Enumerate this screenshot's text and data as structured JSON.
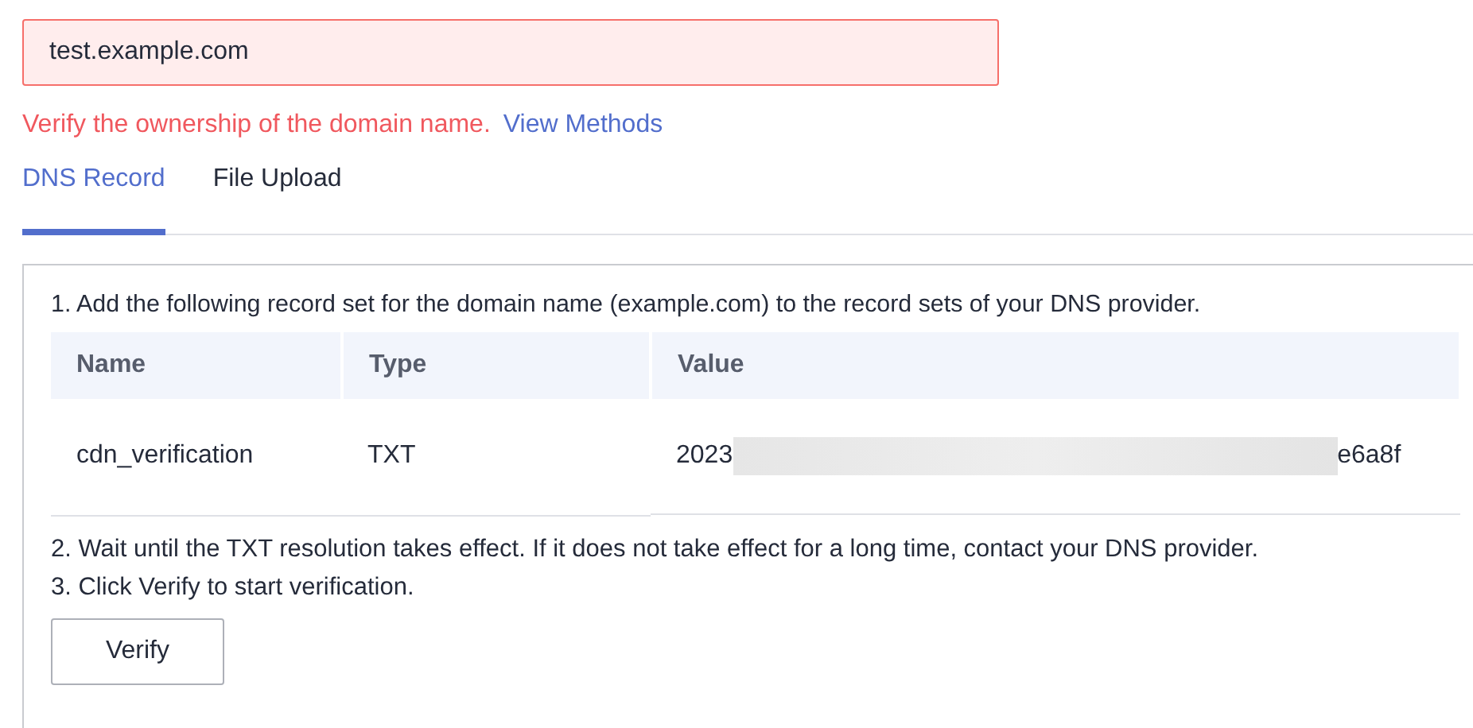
{
  "domain_field": {
    "value": "test.example.com",
    "invalid": true
  },
  "error": {
    "message": "Verify the ownership of the domain name.",
    "link": "View Methods"
  },
  "tabs": [
    {
      "label": "DNS Record",
      "selected": true
    },
    {
      "label": "File Upload",
      "selected": false
    }
  ],
  "steps": [
    {
      "kind": "text",
      "text": "1. Add the following record set for the domain name (example.com) to the record sets of your DNS provider."
    },
    {
      "kind": "table",
      "columns": [
        "Name",
        "Type",
        "Value"
      ],
      "rows": [
        {
          "name": "cdn_verification",
          "type": "TXT",
          "value_start": "2023",
          "value_end": "e6a8f",
          "redacted": true
        }
      ]
    },
    {
      "kind": "text",
      "text": "2. Wait until the TXT resolution takes effect. If it does not take effect for a long time, contact your DNS provider."
    },
    {
      "kind": "text",
      "text": "3. Click Verify to start verification."
    },
    {
      "kind": "button",
      "label": "Verify"
    }
  ]
}
